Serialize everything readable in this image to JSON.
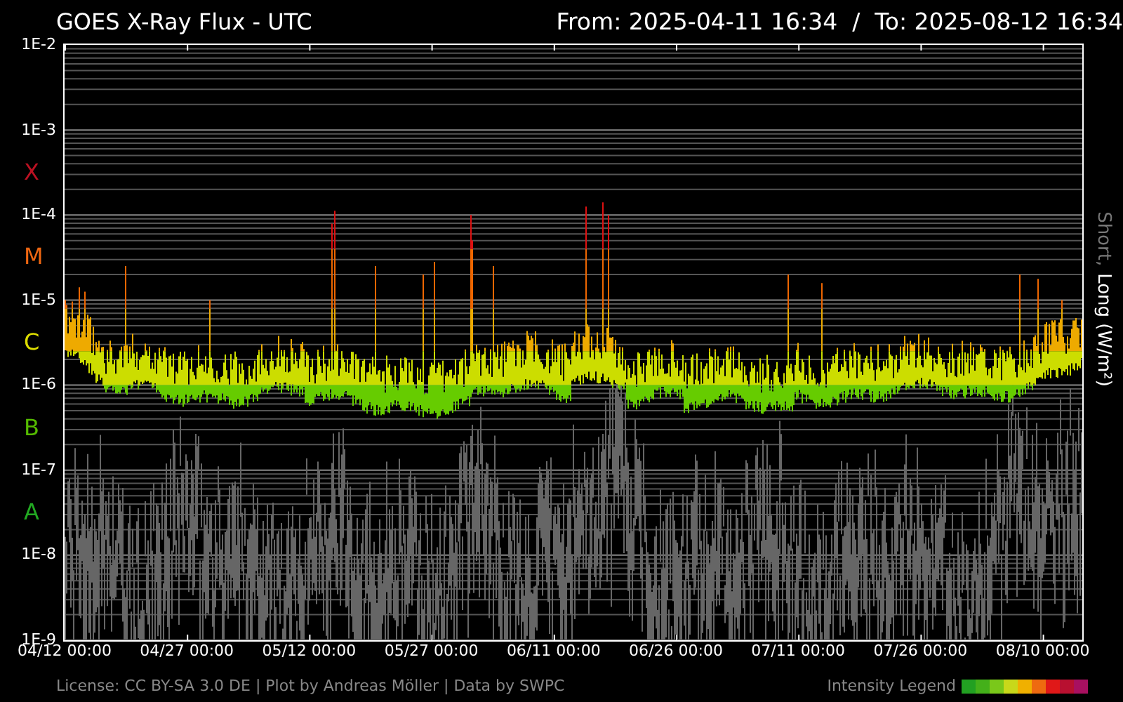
{
  "title": "GOES X-Ray Flux - UTC",
  "range": "From: 2025-04-11 16:34  /  To: 2025-08-12 16:34",
  "y_ticks": [
    "1E-2",
    "1E-3",
    "1E-4",
    "1E-5",
    "1E-6",
    "1E-7",
    "1E-8",
    "1E-9"
  ],
  "flare_classes": [
    {
      "label": "X",
      "color": "#bb1122"
    },
    {
      "label": "M",
      "color": "#ee6611"
    },
    {
      "label": "C",
      "color": "#dddd00"
    },
    {
      "label": "B",
      "color": "#55bb00"
    },
    {
      "label": "A",
      "color": "#22aa22"
    }
  ],
  "x_ticks": [
    "04/12 00:00",
    "04/27 00:00",
    "05/12 00:00",
    "05/27 00:00",
    "06/11 00:00",
    "06/26 00:00",
    "07/11 00:00",
    "07/26 00:00",
    "08/10 00:00"
  ],
  "axis_label": [
    {
      "text": "Short,",
      "kind": "short"
    },
    {
      "text": "Long (W/m²)",
      "kind": "long"
    }
  ],
  "license": "License: CC BY-SA 3.0 DE | Plot by Andreas Möller | Data by SWPC",
  "legend": {
    "label": "Intensity Legend",
    "colors": [
      {
        "color": "#22a022"
      },
      {
        "color": "#44b01a"
      },
      {
        "color": "#7ac81a"
      },
      {
        "color": "#c8d81a"
      },
      {
        "color": "#f0b000"
      },
      {
        "color": "#ee6a10"
      },
      {
        "color": "#e01818"
      },
      {
        "color": "#b81030"
      },
      {
        "color": "#a81060"
      }
    ]
  }
}
